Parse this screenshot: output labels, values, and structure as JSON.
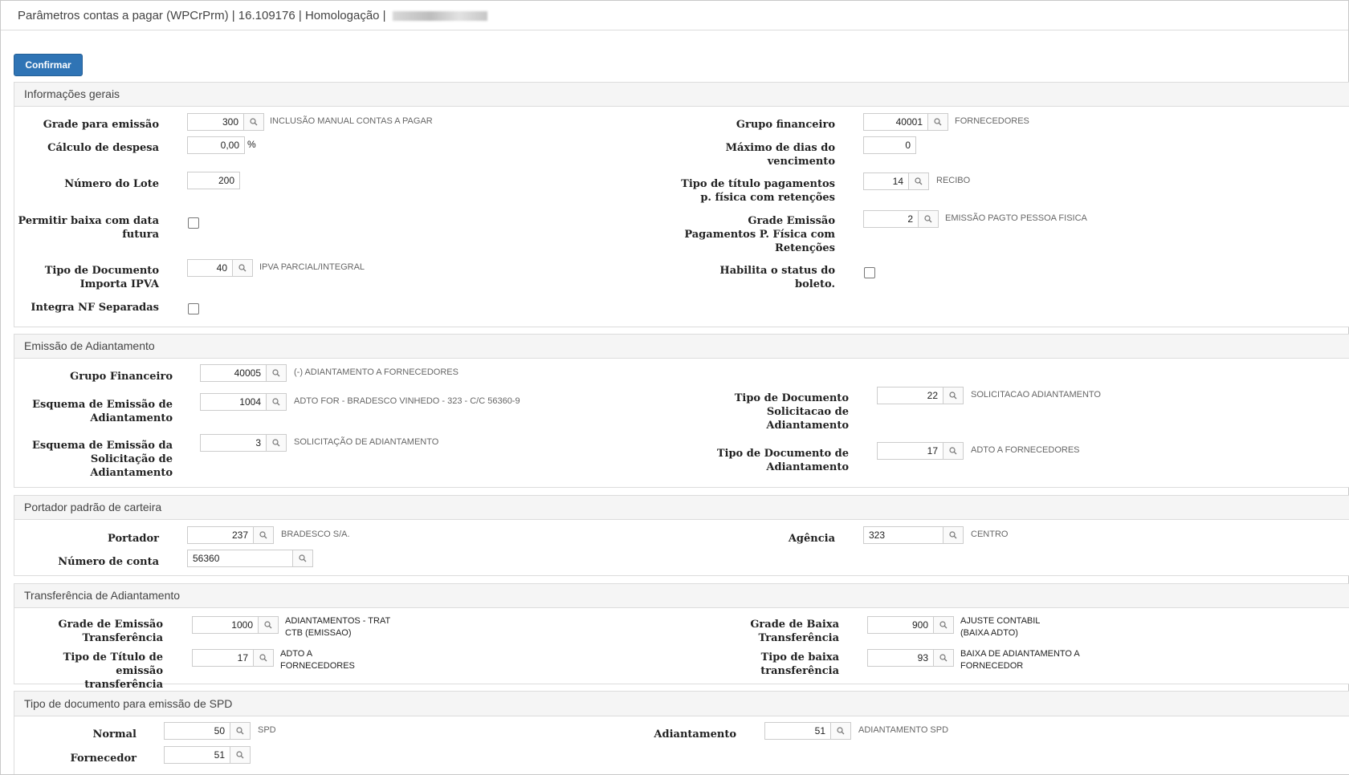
{
  "window": {
    "title": "Parâmetros contas a pagar (WPCrPrm) | 16.109176 | Homologação |"
  },
  "toolbar": {
    "confirm_label": "Confirmar"
  },
  "sections": {
    "general": {
      "title": "Informações gerais",
      "grade_emissao": {
        "label": "Grade para emissão",
        "value": "300",
        "desc": "INCLUSÃO MANUAL CONTAS A PAGAR"
      },
      "calculo_despesa": {
        "label": "Cálculo de despesa",
        "value": "0,00",
        "unit": "%"
      },
      "numero_lote": {
        "label": "Número do Lote",
        "value": "200"
      },
      "permitir_baixa": {
        "label_l1": "Permitir baixa com data",
        "label_l2": "futura"
      },
      "tipo_doc_ipva": {
        "label_l1": "Tipo de Documento",
        "label_l2": "Importa IPVA",
        "value": "40",
        "desc": "IPVA PARCIAL/INTEGRAL"
      },
      "integra_nf": {
        "label": "Integra NF Separadas"
      },
      "grupo_financeiro": {
        "label": "Grupo financeiro",
        "value": "40001",
        "desc": "FORNECEDORES"
      },
      "max_dias": {
        "label_l1": "Máximo de dias do",
        "label_l2": "vencimento",
        "value": "0"
      },
      "tipo_titulo_pf": {
        "label_l1": "Tipo de título pagamentos",
        "label_l2": "p. física com retenções",
        "value": "14",
        "desc": "RECIBO"
      },
      "grade_emissao_pf": {
        "label_l1": "Grade Emissão",
        "label_l2": "Pagamentos P. Física com",
        "label_l3": "Retenções",
        "value": "2",
        "desc": "EMISSÃO PAGTO PESSOA FISICA"
      },
      "habilita_boleto": {
        "label_l1": "Habilita o status do",
        "label_l2": "boleto."
      }
    },
    "adiantamento": {
      "title": "Emissão de Adiantamento",
      "grupo_financeiro": {
        "label": "Grupo Financeiro",
        "value": "40005",
        "desc": "(-) ADIANTAMENTO A FORNECEDORES"
      },
      "esquema_emissao": {
        "label_l1": "Esquema de Emissão de",
        "label_l2": "Adiantamento",
        "value": "1004",
        "desc": "ADTO FOR - BRADESCO VINHEDO - 323 - C/C 56360-9"
      },
      "esquema_solicitacao": {
        "label_l1": "Esquema de Emissão da",
        "label_l2": "Solicitação de",
        "label_l3": "Adiantamento",
        "value": "3",
        "desc": "SOLICITAÇÃO DE ADIANTAMENTO"
      },
      "tipo_doc_solicitacao": {
        "label_l1": "Tipo de Documento",
        "label_l2": "Solicitacao de",
        "label_l3": "Adiantamento",
        "value": "22",
        "desc": "SOLICITACAO ADIANTAMENTO"
      },
      "tipo_doc_adiantamento": {
        "label_l1": "Tipo de Documento de",
        "label_l2": "Adiantamento",
        "value": "17",
        "desc": "ADTO A FORNECEDORES"
      }
    },
    "portador": {
      "title": "Portador padrão de carteira",
      "portador": {
        "label": "Portador",
        "value": "237",
        "desc": "BRADESCO S/A."
      },
      "numero_conta": {
        "label": "Número de conta",
        "value": "56360"
      },
      "agencia": {
        "label": "Agência",
        "value": "323",
        "desc": "CENTRO"
      }
    },
    "transferencia": {
      "title": "Transferência de Adiantamento",
      "grade_emissao": {
        "label_l1": "Grade de Emissão",
        "label_l2": "Transferência",
        "value": "1000",
        "desc_l1": "ADIANTAMENTOS - TRAT",
        "desc_l2": "CTB (EMISSAO)"
      },
      "tipo_titulo": {
        "label_l1": "Tipo de Título de emissão",
        "label_l2": "transferência",
        "value": "17",
        "desc_l1": "ADTO A",
        "desc_l2": "FORNECEDORES"
      },
      "grade_baixa": {
        "label_l1": "Grade de Baixa",
        "label_l2": "Transferência",
        "value": "900",
        "desc_l1": "AJUSTE CONTABIL",
        "desc_l2": "(BAIXA ADTO)"
      },
      "tipo_baixa": {
        "label_l1": "Tipo de baixa",
        "label_l2": "transferência",
        "value": "93",
        "desc_l1": "BAIXA DE ADIANTAMENTO A",
        "desc_l2": "FORNECEDOR"
      }
    },
    "spd": {
      "title": "Tipo de documento para emissão de SPD",
      "normal": {
        "label": "Normal",
        "value": "50",
        "desc": "SPD"
      },
      "fornecedor": {
        "label": "Fornecedor",
        "value": "51"
      },
      "adiantamento": {
        "label": "Adiantamento",
        "value": "51",
        "desc": "ADIANTAMENTO SPD"
      }
    }
  }
}
